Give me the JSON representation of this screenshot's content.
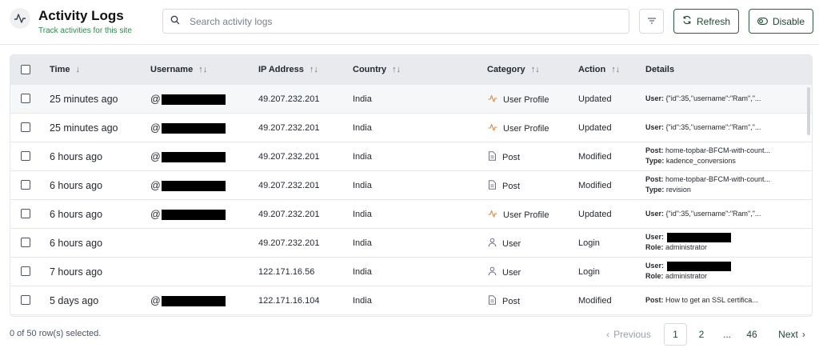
{
  "header": {
    "title": "Activity Logs",
    "subtitle": "Track activities for this site",
    "icon": "activity-icon"
  },
  "search": {
    "placeholder": "Search activity logs",
    "value": ""
  },
  "toolbar": {
    "refresh_label": "Refresh",
    "disable_label": "Disable"
  },
  "table": {
    "columns": {
      "time": "Time",
      "username": "Username",
      "ip": "IP Address",
      "country": "Country",
      "category": "Category",
      "action": "Action",
      "details": "Details"
    },
    "rows": [
      {
        "time": "25 minutes ago",
        "at": "@",
        "redacted": true,
        "ip": "49.207.232.201",
        "country": "India",
        "category": "User Profile",
        "cat_icon": "activity-icon",
        "action": "Updated",
        "d1k": "User:",
        "d1v": " {\"id\":35,\"username\":\"Ram\",\"...",
        "d2k": "",
        "d2v": ""
      },
      {
        "time": "25 minutes ago",
        "at": "@",
        "redacted": true,
        "ip": "49.207.232.201",
        "country": "India",
        "category": "User Profile",
        "cat_icon": "activity-icon",
        "action": "Updated",
        "d1k": "User:",
        "d1v": " {\"id\":35,\"username\":\"Ram\",\"...",
        "d2k": "",
        "d2v": ""
      },
      {
        "time": "6 hours ago",
        "at": "@",
        "redacted": true,
        "ip": "49.207.232.201",
        "country": "India",
        "category": "Post",
        "cat_icon": "document-icon",
        "action": "Modified",
        "d1k": "Post:",
        "d1v": " home-topbar-BFCM-with-count...",
        "d2k": "Type:",
        "d2v": " kadence_conversions"
      },
      {
        "time": "6 hours ago",
        "at": "@",
        "redacted": true,
        "ip": "49.207.232.201",
        "country": "India",
        "category": "Post",
        "cat_icon": "document-icon",
        "action": "Modified",
        "d1k": "Post:",
        "d1v": " home-topbar-BFCM-with-count...",
        "d2k": "Type:",
        "d2v": " revision"
      },
      {
        "time": "6 hours ago",
        "at": "@",
        "redacted": true,
        "ip": "49.207.232.201",
        "country": "India",
        "category": "User Profile",
        "cat_icon": "activity-icon",
        "action": "Updated",
        "d1k": "User:",
        "d1v": " {\"id\":35,\"username\":\"Ram\",\"...",
        "d2k": "",
        "d2v": ""
      },
      {
        "time": "6 hours ago",
        "at": "",
        "redacted": false,
        "ip": "49.207.232.201",
        "country": "India",
        "category": "User",
        "cat_icon": "user-icon",
        "action": "Login",
        "d1k": "User:",
        "d1v": "",
        "d1redact": true,
        "d2k": "Role:",
        "d2v": " administrator"
      },
      {
        "time": "7 hours ago",
        "at": "",
        "redacted": false,
        "ip": "122.171.16.56",
        "country": "India",
        "category": "User",
        "cat_icon": "user-icon",
        "action": "Login",
        "d1k": "User:",
        "d1v": "",
        "d1redact": true,
        "d2k": "Role:",
        "d2v": " administrator"
      },
      {
        "time": "5 days ago",
        "at": "@",
        "redacted": true,
        "ip": "122.171.16.104",
        "country": "India",
        "category": "Post",
        "cat_icon": "document-icon",
        "action": "Modified",
        "d1k": "Post:",
        "d1v": " How to get an SSL certifica...",
        "d2k": "",
        "d2v": ""
      }
    ]
  },
  "footer": {
    "selection": "0 of 50 row(s) selected.",
    "previous": "Previous",
    "pages": [
      "1",
      "2",
      "...",
      "46"
    ],
    "next": "Next"
  },
  "colors": {
    "accent": "#2f8a4e",
    "category_icon": "#e08a3a",
    "button_border": "#2f5f42"
  }
}
